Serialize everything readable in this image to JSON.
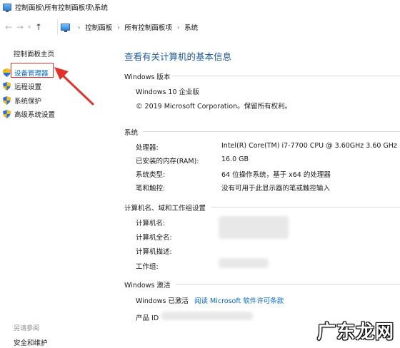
{
  "window": {
    "title": "控制面板\\所有控制面板项\\系统"
  },
  "address": {
    "breadcrumbs": [
      "控制面板",
      "所有控制面板项",
      "系统"
    ]
  },
  "leftnav": {
    "home": "控制面板主页",
    "items": [
      {
        "label": "设备管理器",
        "icon": "shield-icon"
      },
      {
        "label": "远程设置",
        "icon": "shield-icon"
      },
      {
        "label": "系统保护",
        "icon": "shield-icon"
      },
      {
        "label": "高级系统设置",
        "icon": "shield-icon"
      }
    ],
    "see_also": "另请参阅",
    "security": "安全和维护"
  },
  "main": {
    "title": "查看有关计算机的基本信息",
    "windows_edition": {
      "heading": "Windows 版本",
      "edition": "Windows 10 企业版",
      "copyright": "© 2019 Microsoft Corporation。保留所有权利。"
    },
    "system": {
      "heading": "系统",
      "rows": [
        {
          "label": "处理器:",
          "value": "Intel(R) Core(TM) i7-7700 CPU @ 3.60GHz   3.60 GHz"
        },
        {
          "label": "已安装的内存(RAM):",
          "value": "16.0 GB"
        },
        {
          "label": "系统类型:",
          "value": "64 位操作系统，基于 x64 的处理器"
        },
        {
          "label": "笔和触控:",
          "value": "没有可用于此显示器的笔或触控输入"
        }
      ]
    },
    "computer_name": {
      "heading": "计算机名、域和工作组设置",
      "rows": [
        {
          "label": "计算机名:"
        },
        {
          "label": "计算机全名:"
        },
        {
          "label": "计算机描述:"
        },
        {
          "label": "工作组:"
        }
      ]
    },
    "activation": {
      "heading": "Windows 激活",
      "status": "Windows 已激活",
      "license_link": "阅读 Microsoft 软件许可条款",
      "product_id_label": "产品 ID"
    }
  },
  "watermark": "广东龙网",
  "colors": {
    "accent": "#0066cc",
    "title_blue": "#1e5aa0",
    "annotation_red": "#e0312b"
  }
}
